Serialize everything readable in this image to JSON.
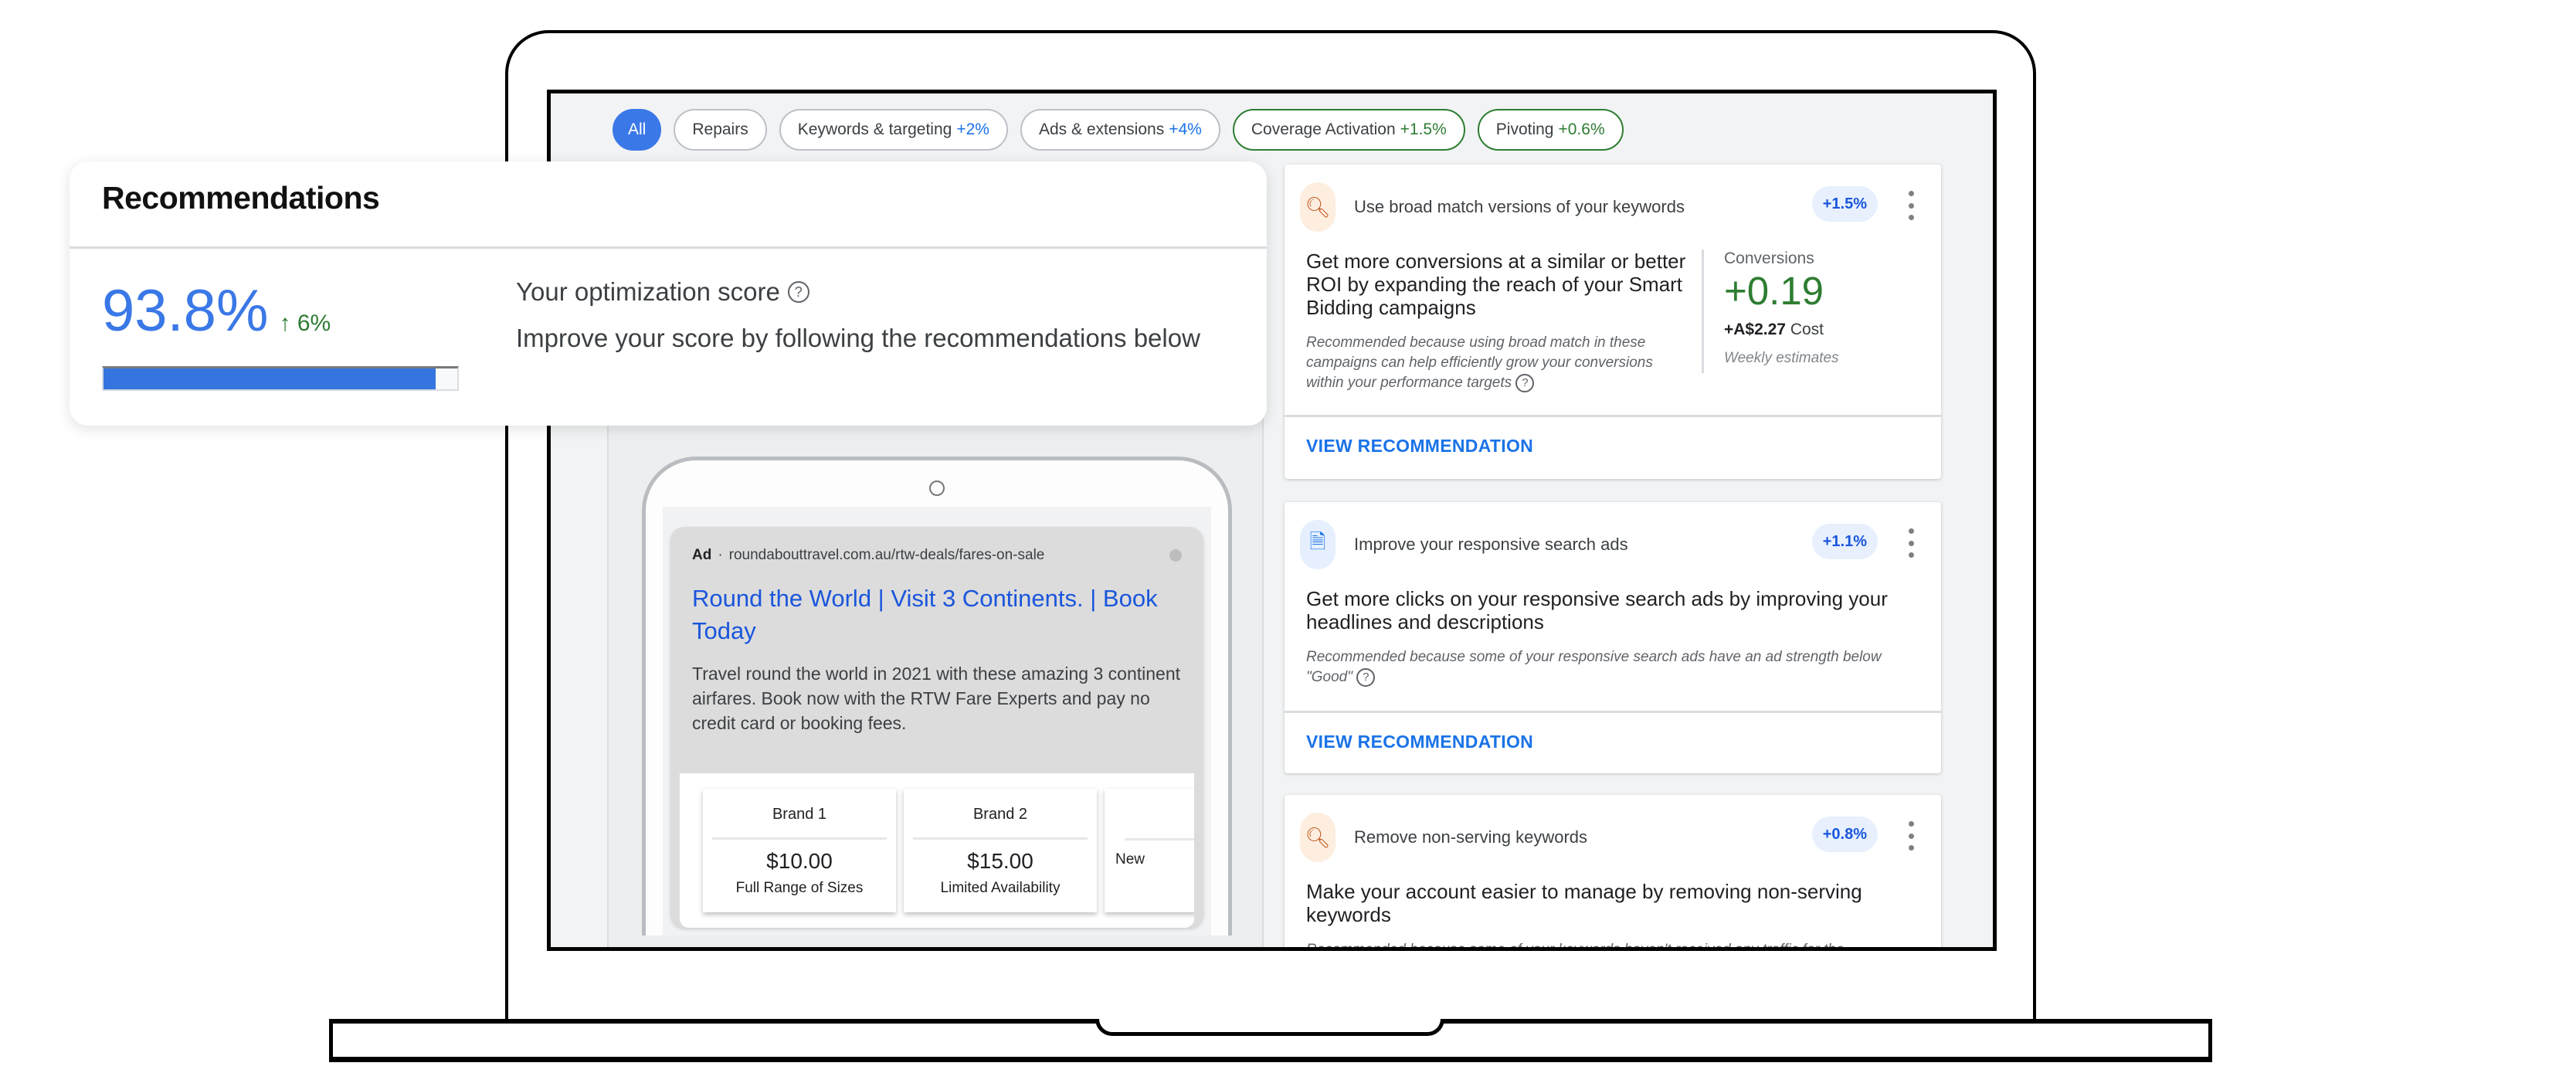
{
  "filters": {
    "chips": [
      {
        "label": "All",
        "delta": "",
        "active": true
      },
      {
        "label": "Repairs",
        "delta": ""
      },
      {
        "label": "Keywords & targeting",
        "delta": "+2%"
      },
      {
        "label": "Ads & extensions",
        "delta": "+4%"
      },
      {
        "label": "Coverage Activation",
        "delta": "+1.5%"
      },
      {
        "label": "Pivoting",
        "delta": "+0.6%"
      }
    ]
  },
  "recommendations": {
    "title": "Recommendations",
    "score": "93.8%",
    "score_change": "↑ 6%",
    "score_progress": 0.938,
    "optimization_label": "Your optimization score",
    "optimization_desc": "Improve your score by following the recommendations below",
    "help_icon": "?"
  },
  "ad_preview": {
    "badge": "Ad",
    "separator": "·",
    "url": "roundabouttravel.com.au/rtw-deals/fares-on-sale",
    "title": "Round the World | Visit 3 Continents. | Book Today",
    "description": "Travel round the world in 2021 with these amazing 3 continent airfares. Book now with the RTW Fare Experts and pay no credit card or booking fees.",
    "cards": [
      {
        "brand": "Brand 1",
        "price": "$10.00",
        "note": "Full Range of Sizes"
      },
      {
        "brand": "Brand 2",
        "price": "$15.00",
        "note": "Limited Availability"
      },
      {
        "brand": "",
        "price": "",
        "note": "New"
      }
    ]
  },
  "cards": [
    {
      "icon": "search-icon",
      "name": "Use broad match versions of your keywords",
      "uplift": "+1.5%",
      "headline": "Get more conversions at a similar or better ROI by expanding the reach of your Smart Bidding campaigns",
      "reason": "Recommended because using broad match in these campaigns can help efficiently grow your conversions within your performance targets",
      "metric_label": "Conversions",
      "metric_value": "+0.19",
      "metric_cost": "+A$2.27",
      "metric_cost_label": "Cost",
      "metric_note": "Weekly estimates",
      "action": "VIEW RECOMMENDATION"
    },
    {
      "icon": "ad-edit-icon",
      "name": "Improve your responsive search ads",
      "uplift": "+1.1%",
      "headline": "Get more clicks on your responsive search ads by improving your headlines and descriptions",
      "reason": "Recommended because some of your responsive search ads have an ad strength below \"Good\"",
      "action": "VIEW RECOMMENDATION"
    },
    {
      "icon": "search-icon",
      "name": "Remove non-serving keywords",
      "uplift": "+0.8%",
      "headline": "Make your account easier to manage by removing non-serving keywords",
      "reason": "Recommended because some of your keywords haven't received any traffic for the"
    }
  ]
}
